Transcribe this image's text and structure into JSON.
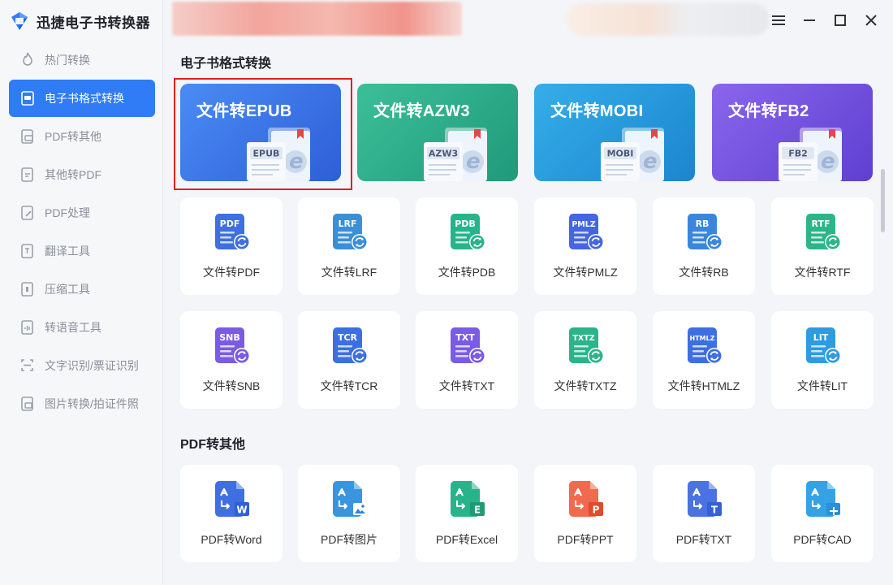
{
  "app": {
    "title": "迅捷电子书转换器"
  },
  "sidebar": {
    "items": [
      {
        "label": "热门转换",
        "icon": "flame-icon",
        "active": false
      },
      {
        "label": "电子书格式转换",
        "icon": "ebook-icon",
        "active": true
      },
      {
        "label": "PDF转其他",
        "icon": "pdf-convert-icon",
        "active": false
      },
      {
        "label": "其他转PDF",
        "icon": "to-pdf-icon",
        "active": false
      },
      {
        "label": "PDF处理",
        "icon": "pdf-edit-icon",
        "active": false
      },
      {
        "label": "翻译工具",
        "icon": "translate-icon",
        "active": false
      },
      {
        "label": "压缩工具",
        "icon": "compress-icon",
        "active": false
      },
      {
        "label": "转语音工具",
        "icon": "voice-icon",
        "active": false
      },
      {
        "label": "文字识别/票证识别",
        "icon": "ocr-icon",
        "active": false
      },
      {
        "label": "图片转换/拍证件照",
        "icon": "image-icon",
        "active": false
      }
    ]
  },
  "main": {
    "section1_title": "电子书格式转换",
    "big_cards": [
      {
        "label": "文件转EPUB",
        "badge": "EPUB",
        "color_from": "#4a8cf4",
        "color_to": "#2e5ed8"
      },
      {
        "label": "文件转AZW3",
        "badge": "AZW3",
        "color_from": "#3cbf98",
        "color_to": "#1f9a7a"
      },
      {
        "label": "文件转MOBI",
        "badge": "MOBI",
        "color_from": "#35aee8",
        "color_to": "#1b85cf"
      },
      {
        "label": "文件转FB2",
        "badge": "FB2",
        "color_from": "#8a66ec",
        "color_to": "#5e3fd0"
      }
    ],
    "format_tiles": [
      {
        "label": "文件转PDF",
        "badge": "PDF",
        "color": "#3f6fe0"
      },
      {
        "label": "文件转LRF",
        "badge": "LRF",
        "color": "#3a8fd8"
      },
      {
        "label": "文件转PDB",
        "badge": "PDB",
        "color": "#27b48a"
      },
      {
        "label": "文件转PMLZ",
        "badge": "PMLZ",
        "color": "#4466e0"
      },
      {
        "label": "文件转RB",
        "badge": "RB",
        "color": "#3a86dc"
      },
      {
        "label": "文件转RTF",
        "badge": "RTF",
        "color": "#2cb588"
      },
      {
        "label": "文件转SNB",
        "badge": "SNB",
        "color": "#7a5ce4"
      },
      {
        "label": "文件转TCR",
        "badge": "TCR",
        "color": "#3d6fe0"
      },
      {
        "label": "文件转TXT",
        "badge": "TXT",
        "color": "#7a5ce4"
      },
      {
        "label": "文件转TXTZ",
        "badge": "TXTZ",
        "color": "#2bb489"
      },
      {
        "label": "文件转HTMLZ",
        "badge": "HTMLZ",
        "color": "#3d6fe0"
      },
      {
        "label": "文件转LIT",
        "badge": "LIT",
        "color": "#2f9be0"
      }
    ],
    "section2_title": "PDF转其他",
    "pdf_tiles": [
      {
        "label": "PDF转Word",
        "badge": "W",
        "color": "#3f6fe0",
        "badge_color": "#2f5fd6"
      },
      {
        "label": "PDF转图片",
        "badge": "img",
        "color": "#3a95df",
        "badge_color": "#2c86d4"
      },
      {
        "label": "PDF转Excel",
        "badge": "E",
        "color": "#27b48a",
        "badge_color": "#1e9b74"
      },
      {
        "label": "PDF转PPT",
        "badge": "P",
        "color": "#f06a4f",
        "badge_color": "#e24a2d"
      },
      {
        "label": "PDF转TXT",
        "badge": "T",
        "color": "#4a72e2",
        "badge_color": "#3560d8"
      },
      {
        "label": "PDF转CAD",
        "badge": "cad",
        "color": "#35a2e6",
        "badge_color": "#2c8fd8"
      }
    ]
  }
}
